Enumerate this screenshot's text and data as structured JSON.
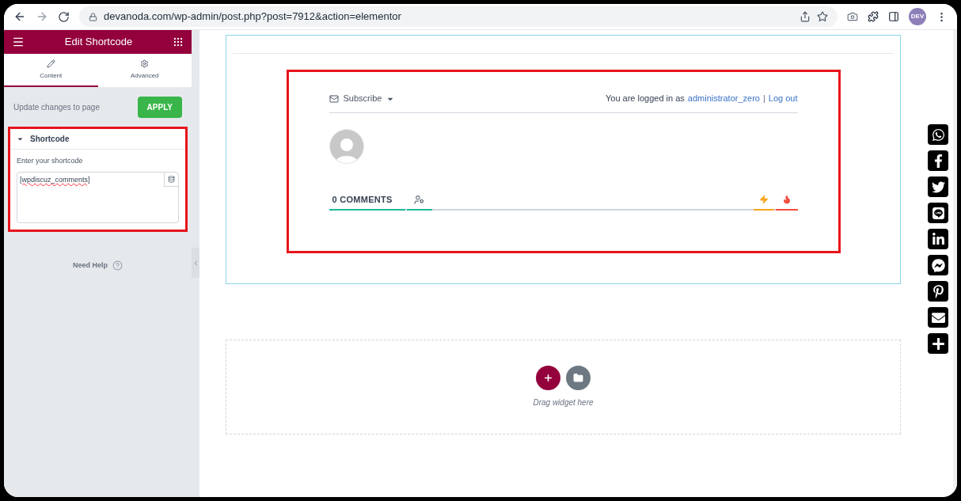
{
  "browser": {
    "url": "devanoda.com/wp-admin/post.php?post=7912&action=elementor",
    "profile_badge": "DEV"
  },
  "sidebar": {
    "title": "Edit Shortcode",
    "tabs": [
      {
        "label": "Content",
        "kind": "pencil",
        "selected": true
      },
      {
        "label": "Advanced",
        "kind": "gear",
        "selected": false
      }
    ],
    "update_label": "Update changes to page",
    "apply_button": "APPLY",
    "section": {
      "title": "Shortcode",
      "expanded": true,
      "field_label": "Enter your shortcode",
      "value": "[wpdiscuz_comments]",
      "highlighted": true
    },
    "help": "Need Help"
  },
  "comments": {
    "highlighted": true,
    "subscribe": "Subscribe",
    "login_prefix": "You are logged in as",
    "user": "administrator_zero",
    "separator": "|",
    "logout": "Log out",
    "count_tab": "0 COMMENTS"
  },
  "drop_zone": {
    "hint": "Drag widget here"
  },
  "share_bar": [
    {
      "kind": "whatsapp"
    },
    {
      "kind": "facebook"
    },
    {
      "kind": "twitter"
    },
    {
      "kind": "line"
    },
    {
      "kind": "linkedin"
    },
    {
      "kind": "messenger"
    },
    {
      "kind": "pinterest"
    },
    {
      "kind": "email"
    },
    {
      "kind": "more"
    }
  ]
}
